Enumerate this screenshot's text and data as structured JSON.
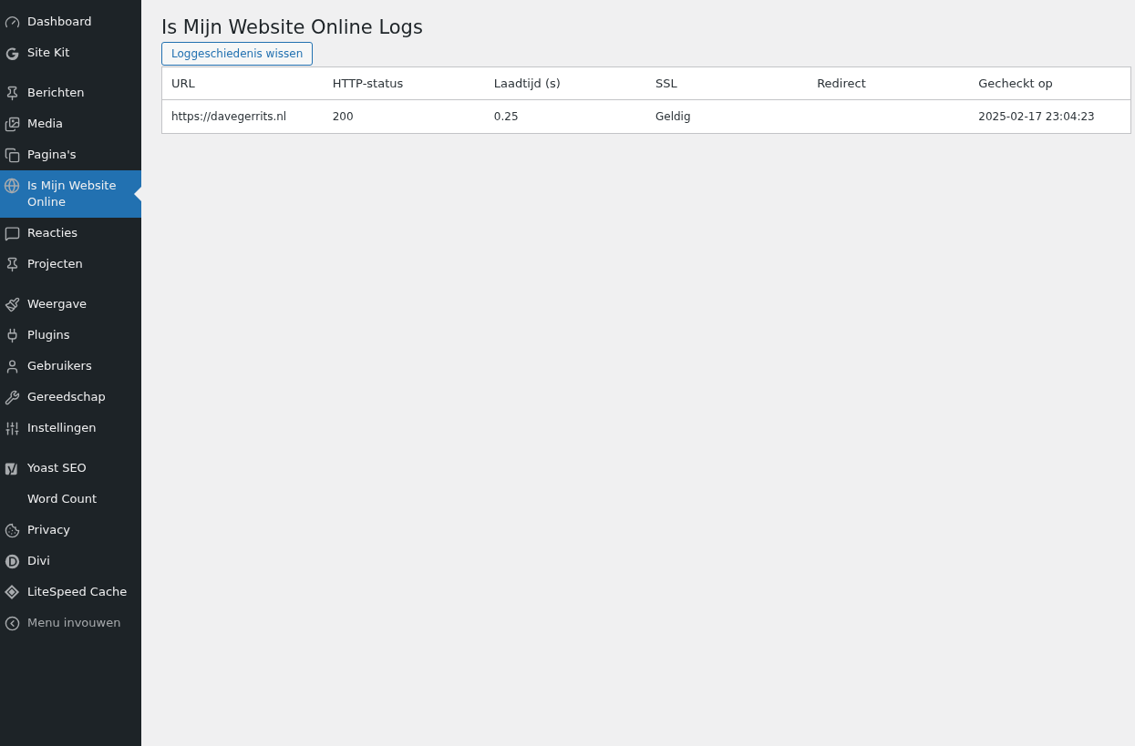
{
  "sidebar": {
    "groups": [
      {
        "items": [
          {
            "label": "Dashboard",
            "kind": "link",
            "selected": false
          },
          {
            "label": "Site Kit",
            "kind": "link",
            "selected": false
          }
        ]
      },
      {
        "items": [
          {
            "label": "Berichten",
            "kind": "link",
            "selected": false
          },
          {
            "label": "Media",
            "kind": "link",
            "selected": false
          },
          {
            "label": "Pagina's",
            "kind": "link",
            "selected": false
          },
          {
            "label": "Is Mijn Website Online",
            "kind": "link",
            "selected": true
          },
          {
            "label": "Reacties",
            "kind": "link",
            "selected": false
          },
          {
            "label": "Projecten",
            "kind": "link",
            "selected": false
          }
        ]
      },
      {
        "items": [
          {
            "label": "Weergave",
            "kind": "link",
            "selected": false
          },
          {
            "label": "Plugins",
            "kind": "link",
            "selected": false
          },
          {
            "label": "Gebruikers",
            "kind": "link",
            "selected": false
          },
          {
            "label": "Gereedschap",
            "kind": "link",
            "selected": false
          },
          {
            "label": "Instellingen",
            "kind": "link",
            "selected": false
          }
        ]
      },
      {
        "items": [
          {
            "label": "Yoast SEO",
            "kind": "link",
            "selected": false
          },
          {
            "label": "Word Count",
            "kind": "link",
            "selected": false
          },
          {
            "label": "Privacy",
            "kind": "link",
            "selected": false
          },
          {
            "label": "Divi",
            "kind": "link",
            "selected": false
          },
          {
            "label": "LiteSpeed Cache",
            "kind": "link",
            "selected": false
          },
          {
            "label": "Menu invouwen",
            "kind": "collapse",
            "selected": false
          }
        ]
      }
    ]
  },
  "page": {
    "title": "Is Mijn Website Online Logs",
    "clear_button": "Loggeschiedenis wissen"
  },
  "table": {
    "columns": [
      "URL",
      "HTTP-status",
      "Laadtijd (s)",
      "SSL",
      "Redirect",
      "Gecheckt op"
    ],
    "rows": [
      [
        "https://davegerrits.nl",
        "200",
        "0.25",
        "Geldig",
        "",
        "2025-02-17 23:04:23"
      ]
    ]
  }
}
